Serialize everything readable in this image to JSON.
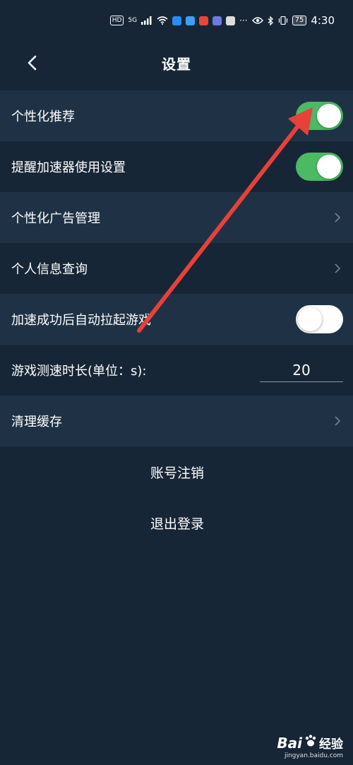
{
  "status_bar": {
    "hd": "HD",
    "network": "5G",
    "battery": "75",
    "time": "4:30"
  },
  "nav": {
    "title": "设置",
    "back_icon": "chevron-left-icon"
  },
  "settings": {
    "personalized_recommendation": {
      "label": "个性化推荐",
      "enabled": true
    },
    "accelerator_reminder": {
      "label": "提醒加速器使用设置",
      "enabled": true
    },
    "ad_management": {
      "label": "个性化广告管理"
    },
    "personal_info": {
      "label": "个人信息查询"
    },
    "auto_launch_game": {
      "label": "加速成功后自动拉起游戏",
      "enabled": false
    },
    "speed_test_duration": {
      "label": "游戏测速时长(单位：s):",
      "value": "20"
    },
    "clear_cache": {
      "label": "清理缓存"
    },
    "cancel_account": {
      "label": "账号注销"
    },
    "logout": {
      "label": "退出登录"
    }
  },
  "colors": {
    "background": "#172636",
    "row_alt": "#1f3245",
    "toggle_on": "#4cb963",
    "annotation_arrow": "#e8403a"
  },
  "watermark": {
    "logo": "Bai",
    "logo_suffix": "经验",
    "url": "jingyan.baidu.com"
  }
}
